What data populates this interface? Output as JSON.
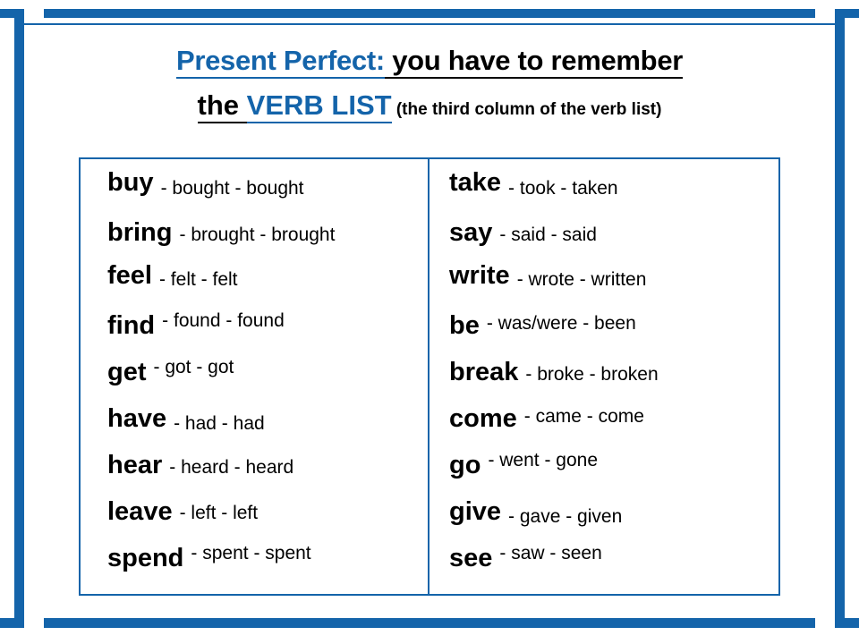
{
  "slide": {
    "title": {
      "part_blue": "Present Perfect:",
      "part_black": " you have to remember",
      "line2_the": "the ",
      "line2_verblist": "VERB LIST",
      "line2_note": " (the third column of the verb list)"
    },
    "colors": {
      "accent_blue": "#1464aa",
      "text_black": "#000000"
    },
    "columns": [
      {
        "id": "left",
        "verbs": [
          {
            "base": "buy",
            "forms": "- bought - bought"
          },
          {
            "base": "bring",
            "forms": "- brought - brought"
          },
          {
            "base": "feel",
            "forms": "- felt - felt"
          },
          {
            "base": "find",
            "forms": "- found - found"
          },
          {
            "base": "get",
            "forms": "- got - got"
          },
          {
            "base": "have",
            "forms": "- had - had"
          },
          {
            "base": "hear",
            "forms": "- heard - heard"
          },
          {
            "base": "leave",
            "forms": "- left - left"
          },
          {
            "base": "spend",
            "forms": "- spent - spent"
          }
        ]
      },
      {
        "id": "right",
        "verbs": [
          {
            "base": "take",
            "forms": "- took - taken"
          },
          {
            "base": "say",
            "forms": "- said - said"
          },
          {
            "base": "write",
            "forms": "- wrote - written"
          },
          {
            "base": "be",
            "forms": "- was/were - been"
          },
          {
            "base": "break",
            "forms": "- broke - broken"
          },
          {
            "base": "come",
            "forms": "- came - come"
          },
          {
            "base": "go",
            "forms": "- went - gone"
          },
          {
            "base": "give",
            "forms": "- gave - given"
          },
          {
            "base": "see",
            "forms": "- saw - seen"
          }
        ]
      }
    ]
  }
}
